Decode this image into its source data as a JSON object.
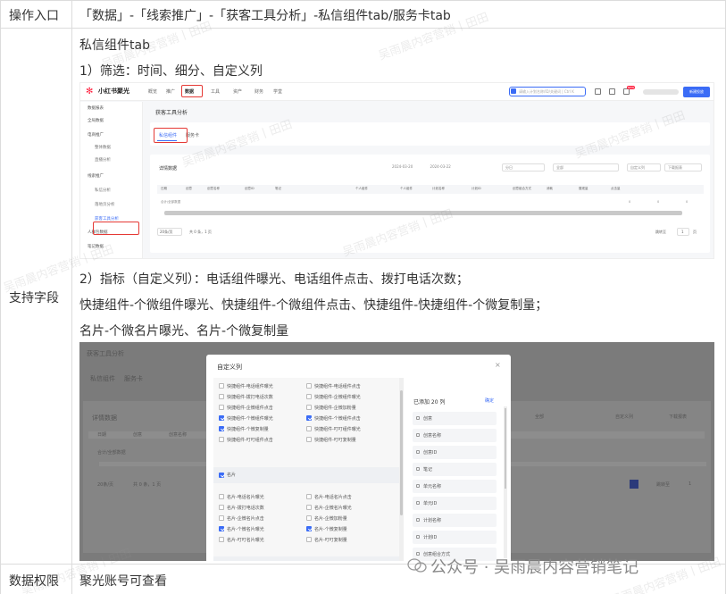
{
  "table": {
    "row1": {
      "label": "操作入口",
      "value": "「数据」-「线索推广」-「获客工具分析」-私信组件tab/服务卡tab"
    },
    "row2": {
      "label": "支持字段",
      "line1": "私信组件tab",
      "line2": "1）筛选：时间、细分、自定义列",
      "line3": "2）指标（自定义列）：电话组件曝光、电话组件点击、拨打电话次数；",
      "line4": "快捷组件-个微组件曝光、快捷组件-个微组件点击、快捷组件-快捷组件-个微复制量；",
      "line5": "名片-个微名片曝光、名片-个微复制量"
    },
    "row3": {
      "label": "数据权限",
      "value": "聚光账号可查看"
    }
  },
  "screenshot1": {
    "logo": "小红书聚光",
    "nav": [
      "概览",
      "推广",
      "数据",
      "工具",
      "资产",
      "财务",
      "学堂"
    ],
    "search_placeholder": "请输入计划名称/ID/关键词 | Ctrl K",
    "badge": "NEW",
    "primary_button": "新建投放",
    "sidebar": [
      {
        "label": "数据报表",
        "sub": false
      },
      {
        "label": "全局数据",
        "sub": false
      },
      {
        "label": "电商推广",
        "sub": false
      },
      {
        "label": "整体数据",
        "sub": true
      },
      {
        "label": "直播分析",
        "sub": true
      },
      {
        "label": "线索推广",
        "sub": false
      },
      {
        "label": "私信分析",
        "sub": true
      },
      {
        "label": "落地页分析",
        "sub": true
      },
      {
        "label": "获客工具分析",
        "sub": true
      },
      {
        "label": "人群包数据",
        "sub": false
      },
      {
        "label": "笔记数据",
        "sub": false
      }
    ],
    "page_title": "获客工具分析",
    "tabs": [
      "私信组件",
      "服务卡"
    ],
    "card_title": "详情数据",
    "date_from": "2024-03-20",
    "date_to": "2024-03-22",
    "filter_breakdown": "分日",
    "filter_all": "全部",
    "custom_columns": "自定义列",
    "download": "下载报表",
    "columns": [
      "日期",
      "创意",
      "创意名称",
      "创意ID",
      "笔记",
      "个人组件",
      "个人组件",
      "计划名称",
      "计划ID",
      "创意组合方式",
      "消耗",
      "展现量",
      "点击量"
    ],
    "summary_row": "合计/全部数据",
    "row_values": [
      "0",
      "0",
      "0"
    ],
    "page_size": "20条/页",
    "total": "共 0 条，1 页",
    "page_current": "1",
    "goto_label": "跳转至",
    "goto_value": "1",
    "page_suffix": "页"
  },
  "screenshot2": {
    "bg_title": "获客工具分析",
    "bg_tabs": [
      "私信组件",
      "服务卡"
    ],
    "bg_card_title": "详情数据",
    "bg_cols": [
      "日期",
      "创意",
      "创意名称"
    ],
    "bg_row": "合计/全部数据",
    "bg_filter": "全部",
    "bg_custom": "自定义列",
    "bg_download": "下载报表",
    "bg_pagesize": "20条/页",
    "bg_total": "共 0 条，1 页",
    "bg_goto": "跳转至",
    "bg_page": "1",
    "modal_title": "自定义列",
    "left_options": [
      {
        "text": "快捷组件-电话组件曝光",
        "on": false,
        "col": 0,
        "row": 0
      },
      {
        "text": "快捷组件-电话组件点击",
        "on": false,
        "col": 1,
        "row": 0
      },
      {
        "text": "快捷组件-拨打电话次数",
        "on": false,
        "col": 0,
        "row": 1
      },
      {
        "text": "快捷组件-企微组件曝光",
        "on": false,
        "col": 1,
        "row": 1
      },
      {
        "text": "快捷组件-企微组件点击",
        "on": false,
        "col": 0,
        "row": 2
      },
      {
        "text": "快捷组件-企微加粉量",
        "on": false,
        "col": 1,
        "row": 2
      },
      {
        "text": "快捷组件-个微组件曝光",
        "on": true,
        "col": 0,
        "row": 3
      },
      {
        "text": "快捷组件-个微组件点击",
        "on": true,
        "col": 1,
        "row": 3
      },
      {
        "text": "快捷组件-个微复制量",
        "on": true,
        "col": 0,
        "row": 4
      },
      {
        "text": "快捷组件-叮叮组件曝光",
        "on": false,
        "col": 1,
        "row": 4
      },
      {
        "text": "快捷组件-叮叮组件点击",
        "on": false,
        "col": 0,
        "row": 5
      },
      {
        "text": "快捷组件-叮叮复制量",
        "on": false,
        "col": 1,
        "row": 5
      }
    ],
    "group_label": "名片",
    "group_options": [
      {
        "text": "名片-电话名片曝光",
        "on": false,
        "col": 0,
        "row": 0
      },
      {
        "text": "名片-电话名片点击",
        "on": false,
        "col": 1,
        "row": 0
      },
      {
        "text": "名片-拨打电话次数",
        "on": false,
        "col": 0,
        "row": 1
      },
      {
        "text": "名片-企微名片曝光",
        "on": false,
        "col": 1,
        "row": 1
      },
      {
        "text": "名片-企微名片点击",
        "on": false,
        "col": 0,
        "row": 2
      },
      {
        "text": "名片-企微加粉量",
        "on": false,
        "col": 1,
        "row": 2
      },
      {
        "text": "名片-个微名片曝光",
        "on": true,
        "col": 0,
        "row": 3
      },
      {
        "text": "名片-个微复制量",
        "on": true,
        "col": 1,
        "row": 3
      },
      {
        "text": "名片-叮叮名片曝光",
        "on": false,
        "col": 0,
        "row": 4
      },
      {
        "text": "名片-叮叮复制量",
        "on": false,
        "col": 1,
        "row": 4
      }
    ],
    "group_label2": "企微组件",
    "right_title": "已添加 20 列",
    "confirm": "确定",
    "right_fields": [
      "创意",
      "创意名称",
      "创意ID",
      "笔记",
      "单元名称",
      "单元ID",
      "计划名称",
      "计划ID",
      "创意组合方式"
    ]
  },
  "watermark": "吴雨晨内容营销丨田田",
  "footer_brand": "公众号 · 吴雨晨内容营销笔记",
  "colors": {
    "accent": "#3b6cf6",
    "highlight_box": "#e53935",
    "brand_red": "#ff2442"
  }
}
